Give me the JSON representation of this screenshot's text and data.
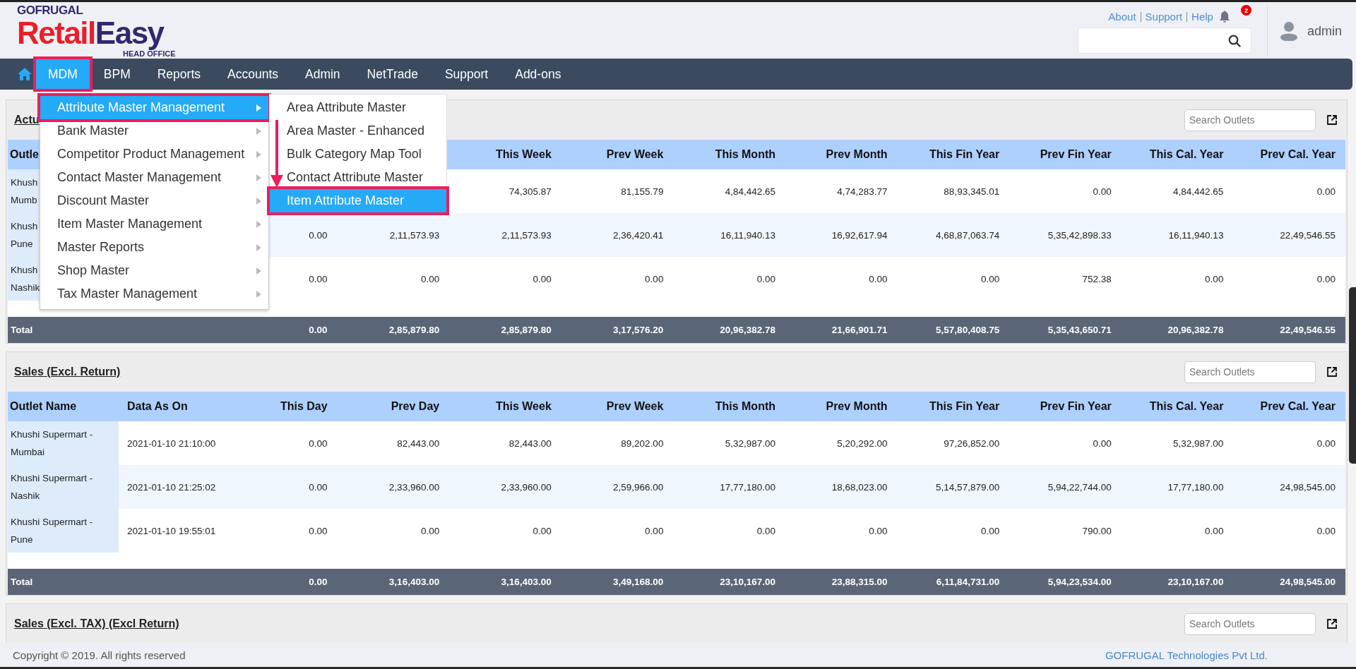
{
  "logo": {
    "brand": "GOFRUGAL",
    "product_first": "Retail",
    "product_second": "Easy",
    "subtitle": "HEAD OFFICE"
  },
  "header_links": [
    "About",
    "Support",
    "Help"
  ],
  "notifications": {
    "count": "2"
  },
  "user": {
    "name": "admin"
  },
  "nav": [
    {
      "label": "MDM",
      "selected": true,
      "annotated": true
    },
    {
      "label": "BPM",
      "selected": false,
      "annotated": false
    },
    {
      "label": "Reports",
      "selected": false,
      "annotated": false
    },
    {
      "label": "Accounts",
      "selected": false,
      "annotated": false
    },
    {
      "label": "Admin",
      "selected": false,
      "annotated": false
    },
    {
      "label": "NetTrade",
      "selected": false,
      "annotated": false
    },
    {
      "label": "Support",
      "selected": false,
      "annotated": false
    },
    {
      "label": "Add-ons",
      "selected": false,
      "annotated": false
    }
  ],
  "menu": {
    "items": [
      {
        "label": "Attribute Master Management",
        "selected": true,
        "annotated": true
      },
      {
        "label": "Bank Master",
        "selected": false,
        "annotated": false
      },
      {
        "label": "Competitor Product Management",
        "selected": false,
        "annotated": false
      },
      {
        "label": "Contact Master Management",
        "selected": false,
        "annotated": false
      },
      {
        "label": "Discount Master",
        "selected": false,
        "annotated": false
      },
      {
        "label": "Item Master Management",
        "selected": false,
        "annotated": false
      },
      {
        "label": "Master Reports",
        "selected": false,
        "annotated": false
      },
      {
        "label": "Shop Master",
        "selected": false,
        "annotated": false
      },
      {
        "label": "Tax Master Management",
        "selected": false,
        "annotated": false
      }
    ],
    "submenu": [
      {
        "label": "Area Attribute Master",
        "selected": false,
        "annotated": false
      },
      {
        "label": "Area Master - Enhanced",
        "selected": false,
        "annotated": false
      },
      {
        "label": "Bulk Category Map Tool",
        "selected": false,
        "annotated": false
      },
      {
        "label": "Contact Attribute Master",
        "selected": false,
        "annotated": false
      },
      {
        "label": "Item Attribute Master",
        "selected": true,
        "annotated": true
      }
    ]
  },
  "panels": [
    {
      "title": "Actu",
      "search_placeholder": "Search Outlets",
      "columns": [
        "Outle",
        null,
        null,
        null,
        "This Week",
        "Prev Week",
        "This Month",
        "Prev Month",
        "This Fin Year",
        "Prev Fin Year",
        "This Cal. Year",
        "Prev Cal. Year"
      ],
      "rows": [
        [
          "Khush\nMumb",
          null,
          null,
          null,
          "74,305.87",
          "81,155.79",
          "4,84,442.65",
          "4,74,283.77",
          "88,93,345.01",
          "0.00",
          "4,84,442.65",
          "0.00"
        ],
        [
          "Khush\nPune",
          null,
          "0.00",
          "2,11,573.93",
          "2,11,573.93",
          "2,36,420.41",
          "16,11,940.13",
          "16,92,617.94",
          "4,68,87,063.74",
          "5,35,42,898.33",
          "16,11,940.13",
          "22,49,546.55"
        ],
        [
          "Khush\nNashik",
          null,
          "0.00",
          "0.00",
          "0.00",
          "0.00",
          "0.00",
          "0.00",
          "0.00",
          "752.38",
          "0.00",
          "0.00"
        ]
      ],
      "total": [
        "Total",
        "0.00",
        "2,85,879.80",
        "2,85,879.80",
        "3,17,576.20",
        "20,96,382.78",
        "21,66,901.71",
        "5,57,80,408.75",
        "5,35,43,650.71",
        "20,96,382.78",
        "22,49,546.55"
      ]
    },
    {
      "title": "Sales (Excl. Return)",
      "search_placeholder": "Search Outlets",
      "columns": [
        "Outlet Name",
        "Data As On",
        "This Day",
        "Prev Day",
        "This Week",
        "Prev Week",
        "This Month",
        "Prev Month",
        "This Fin Year",
        "Prev Fin Year",
        "This Cal. Year",
        "Prev Cal. Year"
      ],
      "rows": [
        [
          "Khushi Supermart - Mumbai",
          "2021-01-10 21:10:00",
          "0.00",
          "82,443.00",
          "82,443.00",
          "89,202.00",
          "5,32,987.00",
          "5,20,292.00",
          "97,26,852.00",
          "0.00",
          "5,32,987.00",
          "0.00"
        ],
        [
          "Khushi Supermart - Nashik",
          "2021-01-10 21:25:02",
          "0.00",
          "2,33,960.00",
          "2,33,960.00",
          "2,59,966.00",
          "17,77,180.00",
          "18,68,023.00",
          "5,14,57,879.00",
          "5,94,22,744.00",
          "17,77,180.00",
          "24,98,545.00"
        ],
        [
          "Khushi Supermart - Pune",
          "2021-01-10 19:55:01",
          "0.00",
          "0.00",
          "0.00",
          "0.00",
          "0.00",
          "0.00",
          "0.00",
          "790.00",
          "0.00",
          "0.00"
        ]
      ],
      "total": [
        "Total",
        "0.00",
        "3,16,403.00",
        "3,16,403.00",
        "3,49,168.00",
        "23,10,167.00",
        "23,88,315.00",
        "6,11,84,731.00",
        "5,94,23,534.00",
        "23,10,167.00",
        "24,98,545.00"
      ]
    },
    {
      "title": "Sales (Excl. TAX) (Excl Return)",
      "search_placeholder": "Search Outlets"
    }
  ],
  "footer": {
    "copyright": "Copyright © 2019. All rights reserved",
    "company": "GOFRUGAL Technologies Pvt Ltd."
  }
}
